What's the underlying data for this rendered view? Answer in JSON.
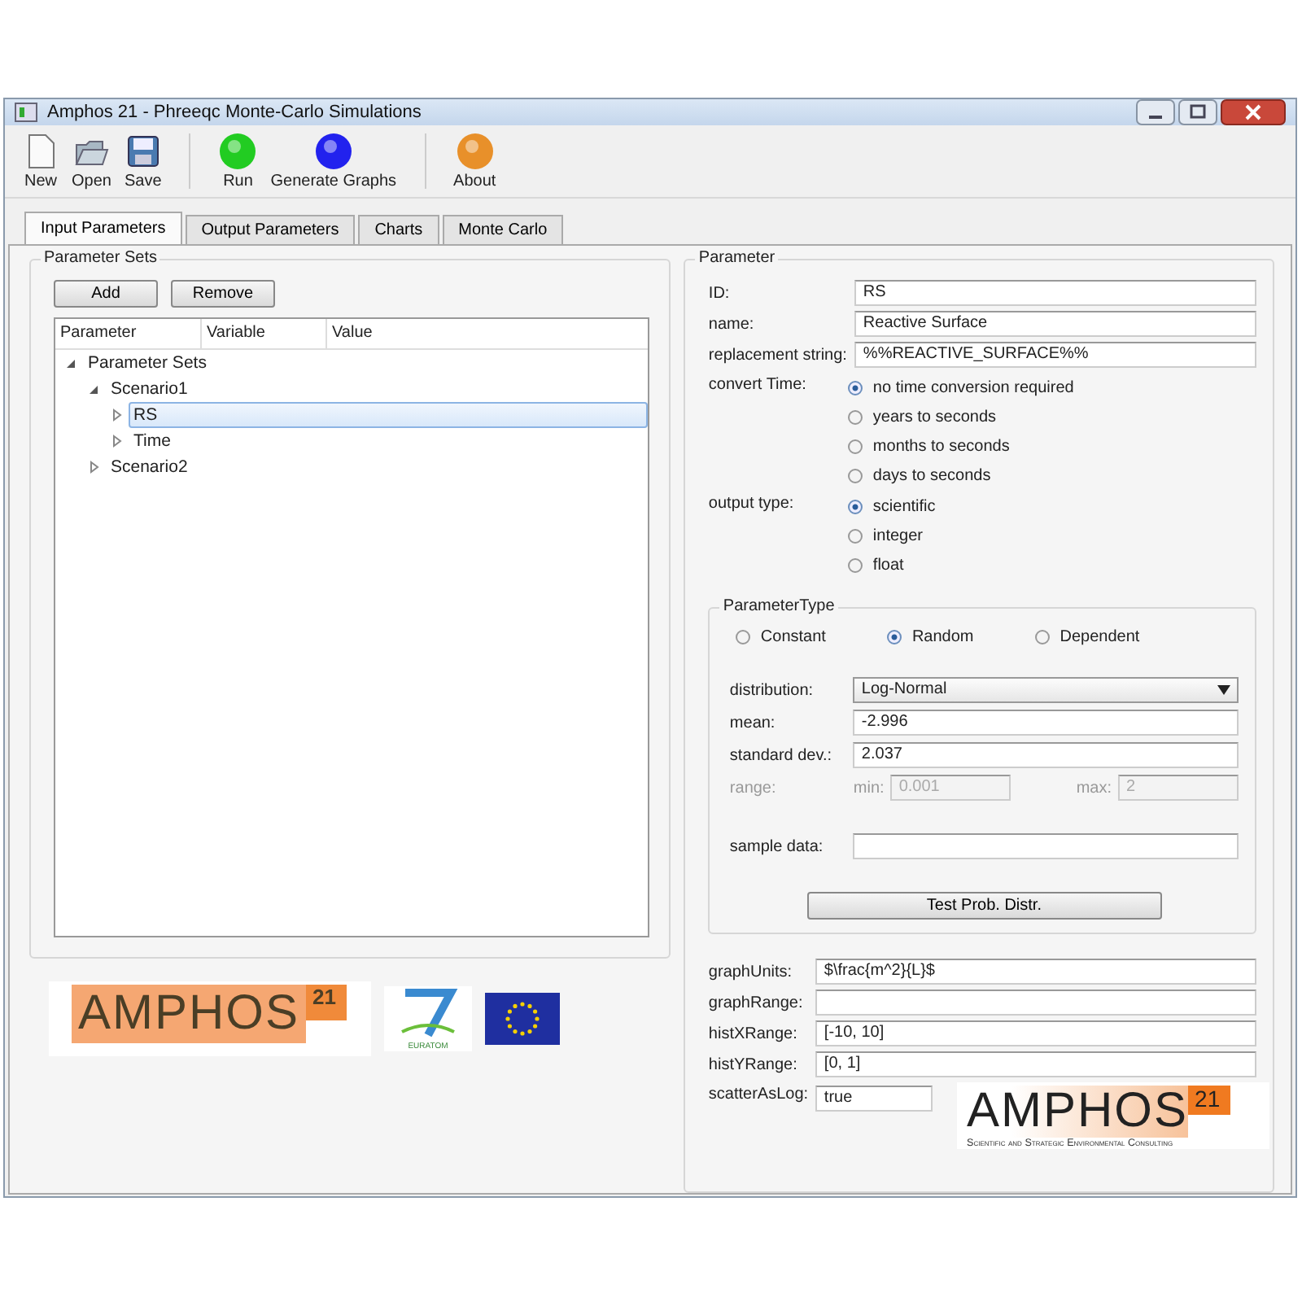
{
  "window": {
    "title": "Amphos 21 - Phreeqc Monte-Carlo Simulations"
  },
  "toolbar": [
    [
      {
        "label": "New",
        "kind": "page"
      },
      {
        "label": "Open",
        "kind": "folder"
      },
      {
        "label": "Save",
        "kind": "disk"
      }
    ],
    [
      {
        "label": "Run",
        "kind": "orb",
        "color": "#22cc22"
      },
      {
        "label": "Generate Graphs",
        "kind": "orb",
        "color": "#2222ee"
      }
    ],
    [
      {
        "label": "About",
        "kind": "orb",
        "color": "#e8902a"
      }
    ]
  ],
  "tabs": [
    {
      "label": "Input Parameters",
      "selected": true
    },
    {
      "label": "Output Parameters",
      "selected": false
    },
    {
      "label": "Charts",
      "selected": false
    },
    {
      "label": "Monte Carlo",
      "selected": false
    }
  ],
  "parameter_sets": {
    "title": "Parameter Sets",
    "buttons": [
      "Add",
      "Remove"
    ],
    "columns": [
      "Parameter",
      "Variable",
      "Value"
    ],
    "tree": [
      {
        "label": "Parameter Sets",
        "expanded": true,
        "selected": false,
        "children": [
          {
            "label": "Scenario1",
            "expanded": true,
            "selected": false,
            "children": [
              {
                "label": "RS",
                "expanded": false,
                "selected": true
              },
              {
                "label": "Time",
                "expanded": false,
                "selected": false
              }
            ]
          },
          {
            "label": "Scenario2",
            "expanded": false,
            "selected": false
          }
        ]
      }
    ]
  },
  "logos": {
    "amphos": {
      "name": "AMPHOS",
      "superscript": "21"
    },
    "fp7": {
      "caption": "EURATOM"
    }
  },
  "parameter": {
    "title": "Parameter",
    "fields": [
      {
        "label": "ID:",
        "value": "RS"
      },
      {
        "label": "name:",
        "value": "Reactive Surface"
      },
      {
        "label": "replacement string:",
        "value": "%%REACTIVE_SURFACE%%"
      }
    ],
    "radio_groups": [
      {
        "label": "convert Time:",
        "options": [
          {
            "label": "no time conversion required",
            "selected": true
          },
          {
            "label": "years to seconds",
            "selected": false
          },
          {
            "label": "months to seconds",
            "selected": false
          },
          {
            "label": "days to seconds",
            "selected": false
          }
        ]
      },
      {
        "label": "output type:",
        "options": [
          {
            "label": "scientific",
            "selected": true
          },
          {
            "label": "integer",
            "selected": false
          },
          {
            "label": "float",
            "selected": false
          }
        ]
      }
    ],
    "parameter_type": {
      "title": "ParameterType",
      "options": [
        {
          "label": "Constant",
          "selected": false
        },
        {
          "label": "Random",
          "selected": true
        },
        {
          "label": "Dependent",
          "selected": false
        }
      ],
      "distribution": {
        "label": "distribution:",
        "value": "Log-Normal"
      },
      "fields": [
        {
          "label": "mean:",
          "value": "-2.996"
        },
        {
          "label": "standard dev.:",
          "value": "2.037"
        }
      ],
      "range": {
        "label": "range:",
        "min_label": "min:",
        "min_value": "0.001",
        "max_label": "max:",
        "max_value": "2",
        "disabled": true
      },
      "sample_data": {
        "label": "sample data:"
      },
      "test_button": "Test Prob. Distr."
    },
    "extra_fields": [
      {
        "label": "graphUnits:",
        "value": "$\\frac{m^2}{L}$"
      },
      {
        "label": "graphRange:"
      },
      {
        "label": "histXRange:",
        "value": "[-10, 10]"
      },
      {
        "label": "histYRange:",
        "value": "[0, 1]"
      },
      {
        "label": "scatterAsLog:",
        "value": "true"
      }
    ]
  },
  "overlay_logo": {
    "name": "AMPHOS",
    "superscript": "21",
    "tagline": "Scientific and Strategic Environmental Consulting"
  }
}
